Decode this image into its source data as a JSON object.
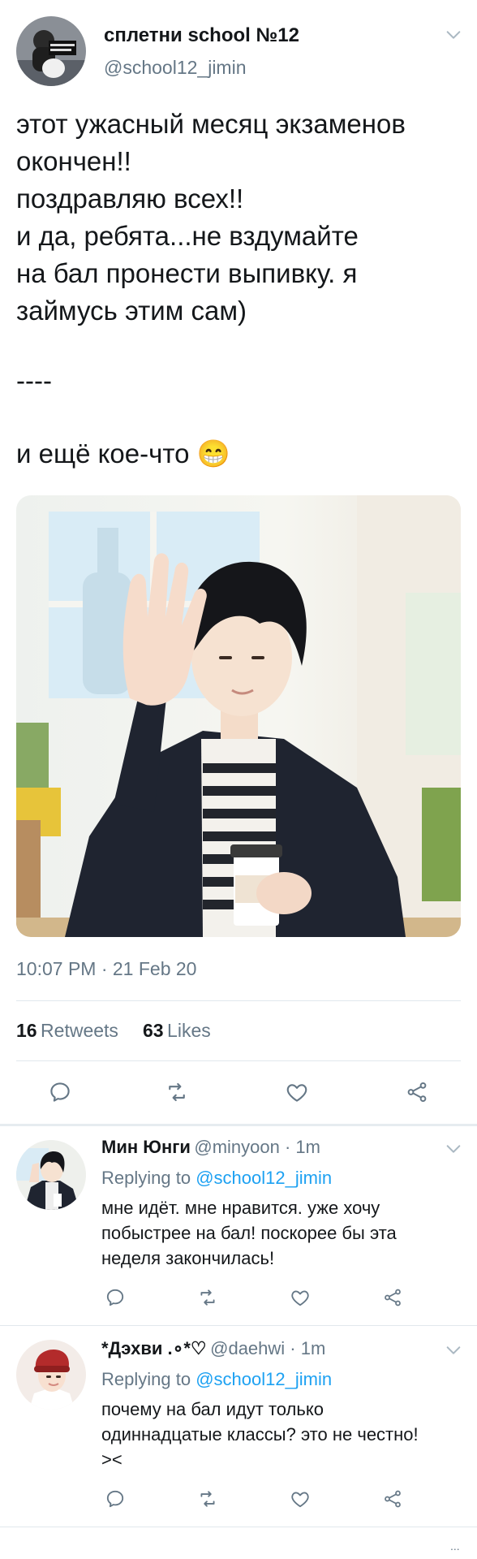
{
  "tweet": {
    "author_name": "сплетни school №12",
    "author_handle": "@school12_jimin",
    "text_lines": [
      "этот ужасный месяц экзаменов",
      "окончен!!",
      "поздравляю всех!!",
      "и да, ребята...не вздумайте",
      "на бал пронести выпивку. я",
      "займусь этим сам)"
    ],
    "separator": "----",
    "extra_line": "и ещё кое-что",
    "emoji": "😁",
    "timestamp": "10:07 PM · 21 Feb 20",
    "retweets_count": "16",
    "retweets_label": "Retweets",
    "likes_count": "63",
    "likes_label": "Likes"
  },
  "replies": [
    {
      "name": "Мин Юнги",
      "handle_time": "@minyoon · 1m",
      "replying_label": "Replying to",
      "replying_to": "@school12_jimin",
      "text_lines": [
        "мне идёт. мне нравится. уже хочу",
        "побыстрее на бал! поскорее бы эта",
        "неделя закончилась!"
      ]
    },
    {
      "name": "*Дэхви .∘*♡",
      "handle_time": "@daehwi · 1m",
      "replying_label": "Replying to",
      "replying_to": "@school12_jimin",
      "text_lines": [
        "почему на бал идут только",
        "одиннадцатые классы? это не честно!",
        "><"
      ]
    }
  ],
  "footer_dots": "...",
  "icons": {
    "reply": "reply-icon",
    "retweet": "retweet-icon",
    "like": "heart-icon",
    "share": "share-icon",
    "more": "chevron-down-icon"
  },
  "colors": {
    "text": "#14171a",
    "muted": "#657786",
    "link": "#1da1f2",
    "divider": "#e1e8ed"
  }
}
